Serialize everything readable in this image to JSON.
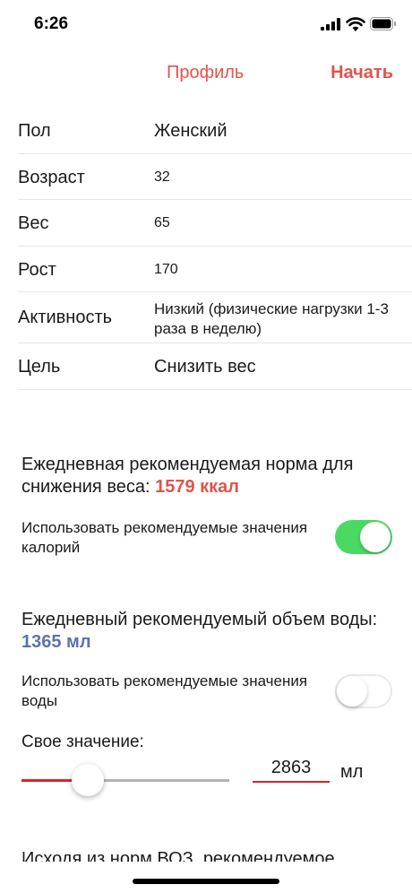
{
  "status_bar": {
    "time": "6:26"
  },
  "nav": {
    "title": "Профиль",
    "action": "Начать"
  },
  "profile": {
    "rows": [
      {
        "label": "Пол",
        "value": "Женский"
      },
      {
        "label": "Возраст",
        "value": "32"
      },
      {
        "label": "Вес",
        "value": "65"
      },
      {
        "label": "Рост",
        "value": "170"
      },
      {
        "label": "Активность",
        "value": "Низкий (физические нагрузки 1-3 раза в неделю)"
      },
      {
        "label": "Цель",
        "value": "Снизить вес"
      }
    ]
  },
  "calories": {
    "text": "Ежедневная рекомендуемая норма для снижения веса:",
    "value": "1579 ккал",
    "option_label": "Использовать рекомендуемые значения калорий",
    "toggle_on": true
  },
  "water": {
    "text": "Ежедневный рекомендуемый объем воды:",
    "value": "1365 мл",
    "option_label": "Использовать рекомендуемые значения воды",
    "toggle_on": false,
    "own_label": "Свое значение:",
    "own_value": "2863",
    "unit": "мл",
    "slider_fraction": 0.32
  },
  "footer_cutoff": "Исходя из норм ВОЗ, рекомендуемое",
  "colors": {
    "accent": "#e0544b",
    "water_accent": "#5b72b3",
    "toggle_on": "#4bd964",
    "slider_red": "#d9262a"
  }
}
